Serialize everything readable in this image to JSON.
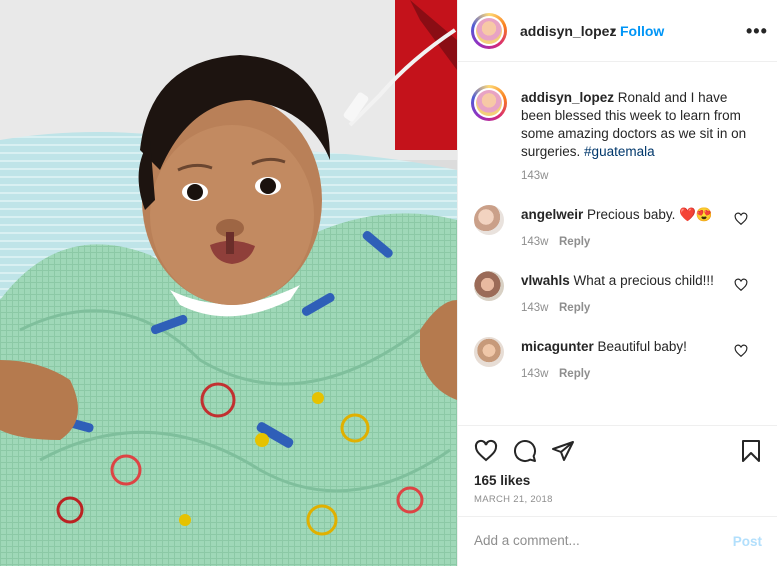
{
  "post": {
    "username": "addisyn_lopez",
    "follow_separator": "•",
    "follow_label": "Follow",
    "more_label": "•••",
    "caption_username": "addisyn_lopez",
    "caption_text": "Ronald and I have been blessed this week to learn from some amazing doctors as we sit in on surgeries.",
    "caption_hashtag": "#guatemala",
    "caption_time": "143w",
    "likes": "165 likes",
    "date": "MARCH 21, 2018"
  },
  "comments": [
    {
      "username": "angelweir",
      "text": "Precious baby. ❤️😍",
      "time": "143w",
      "reply": "Reply"
    },
    {
      "username": "vlwahls",
      "text": "What a precious child!!!",
      "time": "143w",
      "reply": "Reply"
    },
    {
      "username": "micagunter",
      "text": "Beautiful baby!",
      "time": "143w",
      "reply": "Reply"
    }
  ],
  "add_comment": {
    "placeholder": "Add a comment...",
    "post_label": "Post"
  },
  "icons": [
    "heart-icon",
    "comment-icon",
    "share-icon",
    "bookmark-icon",
    "more-icon"
  ],
  "colors": {
    "accent": "#0095f6",
    "post_disabled": "#b2dffc",
    "muted": "#8e8e8e",
    "hashtag": "#00376b"
  }
}
